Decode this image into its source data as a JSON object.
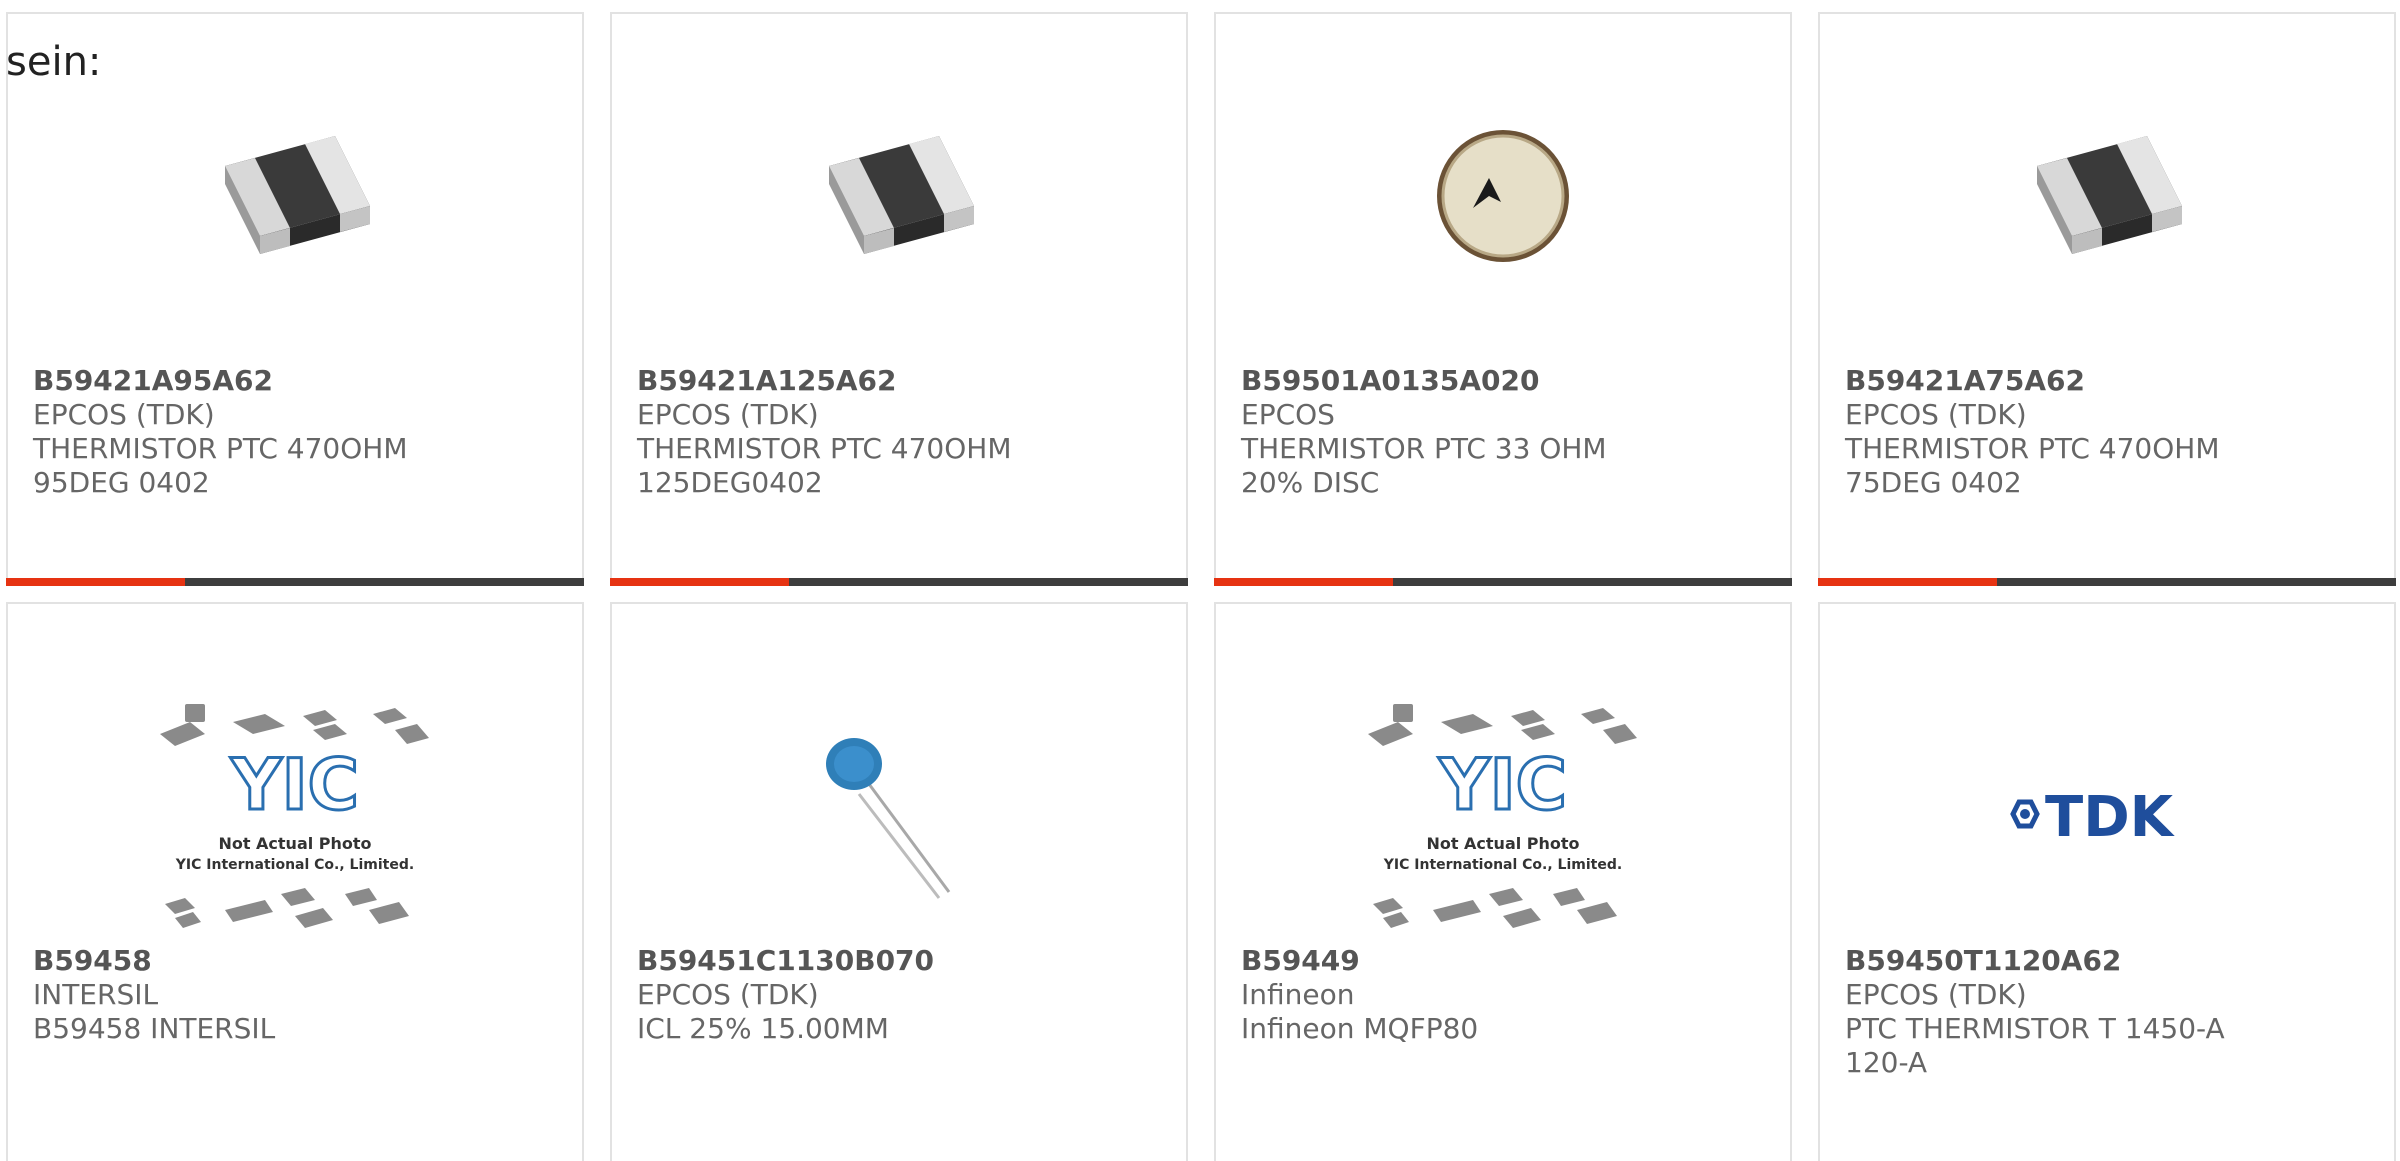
{
  "intro_text": "sein:",
  "accent_color": "#e63312",
  "products": [
    {
      "part": "B59421A95A62",
      "maker": "EPCOS (TDK)",
      "desc": "THERMISTOR PTC 470OHM 95DEG 0402",
      "image": "smd-chip"
    },
    {
      "part": "B59421A125A62",
      "maker": "EPCOS (TDK)",
      "desc": "THERMISTOR PTC 470OHM 125DEG0402",
      "image": "smd-chip"
    },
    {
      "part": "B59501A0135A020",
      "maker": "EPCOS",
      "desc": "THERMISTOR PTC 33 OHM 20% DISC",
      "image": "disc"
    },
    {
      "part": "B59421A75A62",
      "maker": "EPCOS (TDK)",
      "desc": "THERMISTOR PTC 470OHM 75DEG 0402",
      "image": "smd-chip"
    },
    {
      "part": "B59458",
      "maker": "INTERSIL",
      "desc": "B59458 INTERSIL",
      "image": "yic-placeholder"
    },
    {
      "part": "B59451C1130B070",
      "maker": "EPCOS (TDK)",
      "desc": "ICL 25% 15.00MM",
      "image": "radial-disc"
    },
    {
      "part": "B59449",
      "maker": "Infineon",
      "desc": "Infineon MQFP80",
      "image": "yic-placeholder"
    },
    {
      "part": "B59450T1120A62",
      "maker": "EPCOS (TDK)",
      "desc": "PTC THERMISTOR T 1450-A 120-A",
      "image": "tdk-logo"
    }
  ],
  "yic_placeholder": {
    "line1": "Not Actual Photo",
    "line2": "YIC International Co., Limited.",
    "logo": "YIC"
  },
  "tdk_logo_text": "TDK"
}
